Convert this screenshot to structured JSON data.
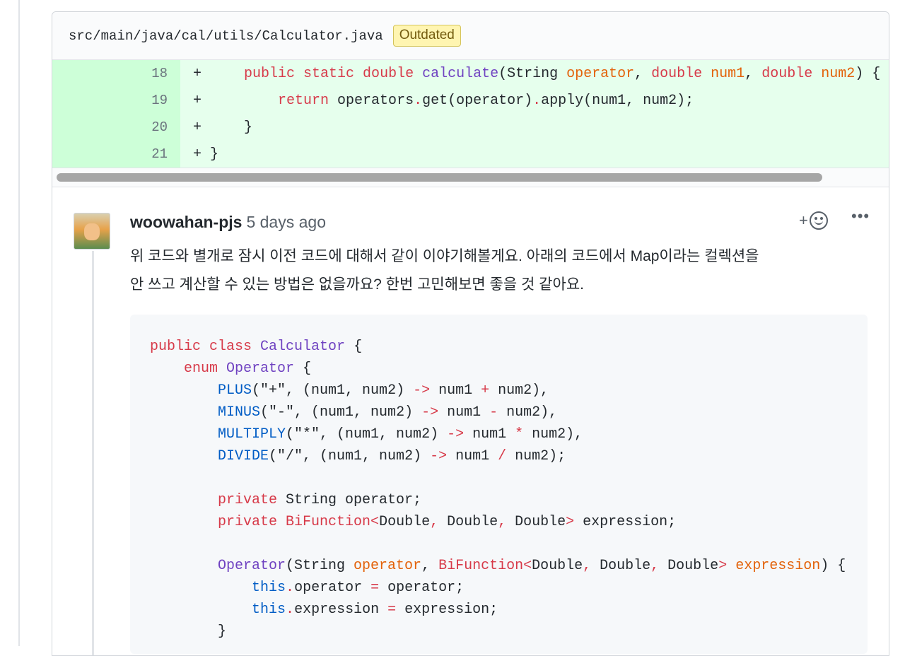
{
  "file": {
    "path": "src/main/java/cal/utils/Calculator.java",
    "badge": "Outdated"
  },
  "diff": [
    {
      "num": "18",
      "prefix": "+",
      "tokens": [
        [
          "p",
          "    "
        ],
        [
          "kw",
          "public static double "
        ],
        [
          "fn",
          "calculate"
        ],
        [
          "p",
          "(String "
        ],
        [
          "pm",
          "operator"
        ],
        [
          "p",
          ", "
        ],
        [
          "kw",
          "double "
        ],
        [
          "pm",
          "num1"
        ],
        [
          "p",
          ", "
        ],
        [
          "kw",
          "double "
        ],
        [
          "pm",
          "num2"
        ],
        [
          "p",
          ") {"
        ]
      ]
    },
    {
      "num": "19",
      "prefix": "+",
      "tokens": [
        [
          "p",
          "        "
        ],
        [
          "kw",
          "return"
        ],
        [
          "p",
          " operators"
        ],
        [
          "kw",
          "."
        ],
        [
          "p",
          "get(operator)"
        ],
        [
          "kw",
          "."
        ],
        [
          "p",
          "apply(num1, num2);"
        ]
      ]
    },
    {
      "num": "20",
      "prefix": "+",
      "tokens": [
        [
          "p",
          "    }"
        ]
      ]
    },
    {
      "num": "21",
      "prefix": "+",
      "tokens": [
        [
          "p",
          "}"
        ]
      ]
    }
  ],
  "comment": {
    "author": "woowahan-pjs",
    "time": "5 days ago",
    "reaction_plus": "+",
    "more": "•••",
    "body_line1": "위 코드와 별개로 잠시 이전 코드에 대해서 같이 이야기해볼게요. 아래의 코드에서 Map이라는 컬렉션을",
    "body_line2": "안 쓰고 계산할 수 있는 방법은 없을까요? 한번 고민해보면 좋을 것 같아요."
  },
  "code": [
    [
      [
        "kw",
        "public class "
      ],
      [
        "fn",
        "Calculator"
      ],
      [
        "p",
        " {"
      ]
    ],
    [
      [
        "p",
        "    "
      ],
      [
        "kw",
        "enum "
      ],
      [
        "fn",
        "Operator"
      ],
      [
        "p",
        " {"
      ]
    ],
    [
      [
        "p",
        "        "
      ],
      [
        "cn",
        "PLUS"
      ],
      [
        "p",
        "(\"+\", (num1, num2) "
      ],
      [
        "kw",
        "->"
      ],
      [
        "p",
        " num1 "
      ],
      [
        "kw",
        "+"
      ],
      [
        "p",
        " num2),"
      ]
    ],
    [
      [
        "p",
        "        "
      ],
      [
        "cn",
        "MINUS"
      ],
      [
        "p",
        "(\"-\", (num1, num2) "
      ],
      [
        "kw",
        "->"
      ],
      [
        "p",
        " num1 "
      ],
      [
        "kw",
        "-"
      ],
      [
        "p",
        " num2),"
      ]
    ],
    [
      [
        "p",
        "        "
      ],
      [
        "cn",
        "MULTIPLY"
      ],
      [
        "p",
        "(\"*\", (num1, num2) "
      ],
      [
        "kw",
        "->"
      ],
      [
        "p",
        " num1 "
      ],
      [
        "kw",
        "*"
      ],
      [
        "p",
        " num2),"
      ]
    ],
    [
      [
        "p",
        "        "
      ],
      [
        "cn",
        "DIVIDE"
      ],
      [
        "p",
        "(\"/\", (num1, num2) "
      ],
      [
        "kw",
        "->"
      ],
      [
        "p",
        " num1 "
      ],
      [
        "kw",
        "/"
      ],
      [
        "p",
        " num2);"
      ]
    ],
    [
      [
        "p",
        ""
      ]
    ],
    [
      [
        "p",
        "        "
      ],
      [
        "kw",
        "private "
      ],
      [
        "p",
        "String operator;"
      ]
    ],
    [
      [
        "p",
        "        "
      ],
      [
        "kw",
        "private BiFunction<"
      ],
      [
        "p",
        "Double"
      ],
      [
        "kw",
        ", "
      ],
      [
        "p",
        "Double"
      ],
      [
        "kw",
        ", "
      ],
      [
        "p",
        "Double"
      ],
      [
        "kw",
        "> "
      ],
      [
        "p",
        "expression;"
      ]
    ],
    [
      [
        "p",
        ""
      ]
    ],
    [
      [
        "p",
        "        "
      ],
      [
        "fn",
        "Operator"
      ],
      [
        "p",
        "(String "
      ],
      [
        "pm",
        "operator"
      ],
      [
        "p",
        ", "
      ],
      [
        "kw",
        "BiFunction<"
      ],
      [
        "p",
        "Double"
      ],
      [
        "kw",
        ", "
      ],
      [
        "p",
        "Double"
      ],
      [
        "kw",
        ", "
      ],
      [
        "p",
        "Double"
      ],
      [
        "kw",
        "> "
      ],
      [
        "pm",
        "expression"
      ],
      [
        "p",
        ") {"
      ]
    ],
    [
      [
        "p",
        "            "
      ],
      [
        "cn",
        "this"
      ],
      [
        "kw",
        "."
      ],
      [
        "p",
        "operator "
      ],
      [
        "kw",
        "="
      ],
      [
        "p",
        " operator;"
      ]
    ],
    [
      [
        "p",
        "            "
      ],
      [
        "cn",
        "this"
      ],
      [
        "kw",
        "."
      ],
      [
        "p",
        "expression "
      ],
      [
        "kw",
        "="
      ],
      [
        "p",
        " expression;"
      ]
    ],
    [
      [
        "p",
        "        }"
      ]
    ]
  ]
}
